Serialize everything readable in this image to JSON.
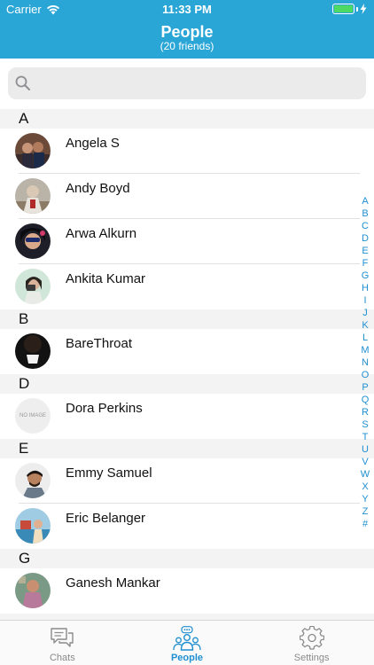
{
  "status_bar": {
    "carrier": "Carrier",
    "time": "11:33 PM"
  },
  "header": {
    "title": "People",
    "subtitle": "(20 friends)"
  },
  "search": {
    "placeholder": ""
  },
  "sections": [
    {
      "letter": "A",
      "contacts": [
        "Angela S",
        "Andy Boyd",
        "Arwa Alkurn",
        "Ankita Kumar"
      ]
    },
    {
      "letter": "B",
      "contacts": [
        "BareThroat"
      ]
    },
    {
      "letter": "D",
      "contacts": [
        "Dora Perkins"
      ]
    },
    {
      "letter": "E",
      "contacts": [
        "Emmy Samuel",
        "Eric Belanger"
      ]
    },
    {
      "letter": "G",
      "contacts": [
        "Ganesh Mankar"
      ]
    }
  ],
  "no_image_text": "NO IMAGE",
  "index_letters": [
    "A",
    "B",
    "C",
    "D",
    "E",
    "F",
    "G",
    "H",
    "I",
    "J",
    "K",
    "L",
    "M",
    "N",
    "O",
    "P",
    "Q",
    "R",
    "S",
    "T",
    "U",
    "V",
    "W",
    "X",
    "Y",
    "Z",
    "#"
  ],
  "tabs": {
    "chats": "Chats",
    "people": "People",
    "settings": "Settings"
  },
  "colors": {
    "header": "#2aa6d6",
    "accent": "#1f8fd0",
    "battery": "#4cd964"
  }
}
